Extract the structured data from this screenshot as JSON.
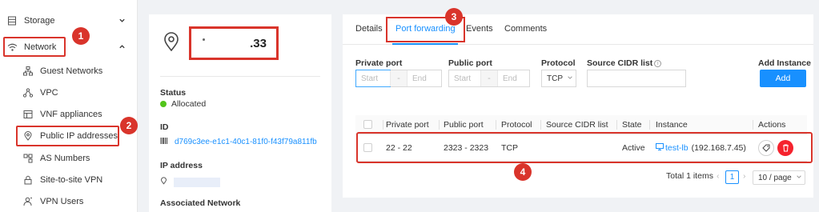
{
  "sidebar": {
    "items": [
      {
        "label": "Storage",
        "icon": "database-icon"
      },
      {
        "label": "Network",
        "icon": "wifi-icon"
      },
      {
        "label": "Guest Networks",
        "icon": "sitemap-icon"
      },
      {
        "label": "VPC",
        "icon": "share-nodes-icon"
      },
      {
        "label": "VNF appliances",
        "icon": "table-icon"
      },
      {
        "label": "Public IP addresses",
        "icon": "map-pin-icon"
      },
      {
        "label": "AS Numbers",
        "icon": "connected-boxes-icon"
      },
      {
        "label": "Site-to-site VPN",
        "icon": "lock-icon"
      },
      {
        "label": "VPN Users",
        "icon": "user-icon"
      }
    ]
  },
  "badges": [
    "1",
    "2",
    "3",
    "4"
  ],
  "detail": {
    "ip_title": ".33",
    "status_label": "Status",
    "status_value": "Allocated",
    "status_color": "#52c41a",
    "id_label": "ID",
    "id_value": "d769c3ee-e1c1-40c1-81f0-f43f79a811fb",
    "ip_label": "IP address",
    "network_label": "Associated Network"
  },
  "tabs": [
    {
      "label": "Details"
    },
    {
      "label": "Port forwarding"
    },
    {
      "label": "Events"
    },
    {
      "label": "Comments"
    }
  ],
  "form": {
    "private_port_label": "Private port",
    "public_port_label": "Public port",
    "protocol_label": "Protocol",
    "cidr_label": "Source CIDR list",
    "add_instance_label": "Add Instance",
    "start_placeholder": "Start",
    "end_placeholder": "End",
    "range_sep": "-",
    "protocol_value": "TCP",
    "add_button": "Add",
    "accent": "#1890ff"
  },
  "table": {
    "columns": [
      "Private port",
      "Public port",
      "Protocol",
      "Source CIDR list",
      "State",
      "Instance",
      "Actions"
    ],
    "rows": [
      {
        "private_port": "22 - 22",
        "public_port": "2323 - 2323",
        "protocol": "TCP",
        "cidr": "",
        "state": "Active",
        "instance_name": "test-lb",
        "instance_ip": "(192.168.7.45)"
      }
    ]
  },
  "pagination": {
    "total": "Total 1 items",
    "current": "1",
    "page_size": "10 / page"
  }
}
